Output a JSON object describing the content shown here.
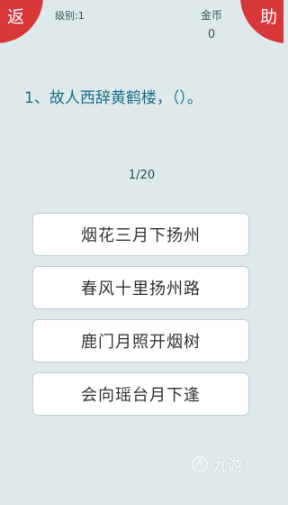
{
  "header": {
    "back_label": "返",
    "help_label": "助",
    "level_text": "级别:1",
    "coins_label": "金币",
    "coins_value": "0"
  },
  "quiz": {
    "question": "1、故人西辞黄鹤楼，（）。",
    "progress": "1/20",
    "options": [
      "烟花三月下扬州",
      "春风十里扬州路",
      "鹿门月照开烟树",
      "会向瑶台月下逢"
    ]
  },
  "watermark": {
    "text": "九游"
  },
  "colors": {
    "background": "#dde9ea",
    "accent_red": "#d8373a",
    "question_text": "#1d6f88"
  }
}
